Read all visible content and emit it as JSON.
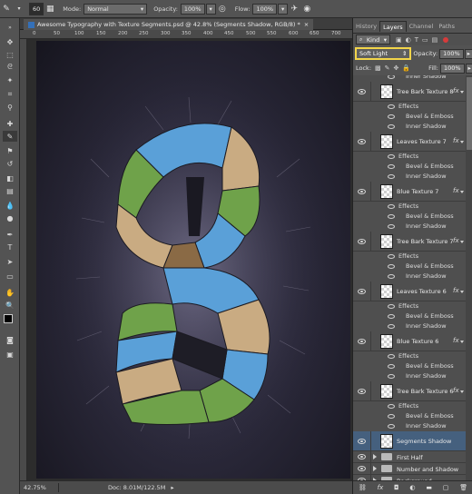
{
  "options_bar": {
    "brush_size": "60",
    "mode_label": "Mode:",
    "mode_value": "Normal",
    "opacity_label": "Opacity:",
    "opacity_value": "100%",
    "flow_label": "Flow:",
    "flow_value": "100%"
  },
  "document": {
    "tab_title": "Awesome Typography with Texture Segments.psd @ 42.8% (Segments Shadow, RGB/8) *",
    "ruler_marks": [
      "0",
      "50",
      "100",
      "150",
      "200",
      "250",
      "300",
      "350",
      "400",
      "450",
      "500",
      "550",
      "600",
      "650",
      "700"
    ]
  },
  "status_bar": {
    "zoom": "42.75%",
    "doc_info": "Doc: 8.01M/122.5M"
  },
  "panel": {
    "tabs": [
      "History",
      "Layers",
      "Channel",
      "Paths"
    ],
    "active_tab": "Layers",
    "kind_label": "Kind",
    "blend_mode": "Soft Light",
    "opacity_label": "Opacity:",
    "opacity_value": "100%",
    "lock_label": "Lock:",
    "fill_label": "Fill:",
    "fill_value": "100%",
    "layers": [
      {
        "name": "Inner Shadow",
        "kind": "effect"
      },
      {
        "name": "Tree Bark Texture 8",
        "kind": "layer",
        "fx": "fx"
      },
      {
        "name": "Effects",
        "kind": "effect"
      },
      {
        "name": "Bevel & Emboss",
        "kind": "effect"
      },
      {
        "name": "Inner Shadow",
        "kind": "effect"
      },
      {
        "name": "Leaves Texture 7",
        "kind": "layer",
        "fx": "fx"
      },
      {
        "name": "Effects",
        "kind": "effect"
      },
      {
        "name": "Bevel & Emboss",
        "kind": "effect"
      },
      {
        "name": "Inner Shadow",
        "kind": "effect"
      },
      {
        "name": "Blue Texture 7",
        "kind": "layer",
        "fx": "fx"
      },
      {
        "name": "Effects",
        "kind": "effect"
      },
      {
        "name": "Bevel & Emboss",
        "kind": "effect"
      },
      {
        "name": "Inner Shadow",
        "kind": "effect"
      },
      {
        "name": "Tree Bark Texture 7",
        "kind": "layer",
        "fx": "fx"
      },
      {
        "name": "Effects",
        "kind": "effect"
      },
      {
        "name": "Bevel & Emboss",
        "kind": "effect"
      },
      {
        "name": "Inner Shadow",
        "kind": "effect"
      },
      {
        "name": "Leaves Texture 6",
        "kind": "layer",
        "fx": "fx"
      },
      {
        "name": "Effects",
        "kind": "effect"
      },
      {
        "name": "Bevel & Emboss",
        "kind": "effect"
      },
      {
        "name": "Inner Shadow",
        "kind": "effect"
      },
      {
        "name": "Blue Texture 6",
        "kind": "layer",
        "fx": "fx"
      },
      {
        "name": "Effects",
        "kind": "effect"
      },
      {
        "name": "Bevel & Emboss",
        "kind": "effect"
      },
      {
        "name": "Inner Shadow",
        "kind": "effect"
      },
      {
        "name": "Tree Bark Texture 6",
        "kind": "layer",
        "fx": "fx"
      },
      {
        "name": "Effects",
        "kind": "effect"
      },
      {
        "name": "Bevel & Emboss",
        "kind": "effect"
      },
      {
        "name": "Inner Shadow",
        "kind": "effect"
      },
      {
        "name": "Segments Shadow",
        "kind": "layer",
        "selected": true
      },
      {
        "name": "First Half",
        "kind": "group"
      },
      {
        "name": "Number and Shadow",
        "kind": "group"
      },
      {
        "name": "Background",
        "kind": "group"
      }
    ]
  },
  "colors": {
    "accent_highlight": "#f2d54a",
    "selected_layer": "#45607e",
    "blue_segment": "#5aa0d8",
    "leaf_segment": "#6fa24a",
    "bark_segment": "#c9ab82"
  }
}
